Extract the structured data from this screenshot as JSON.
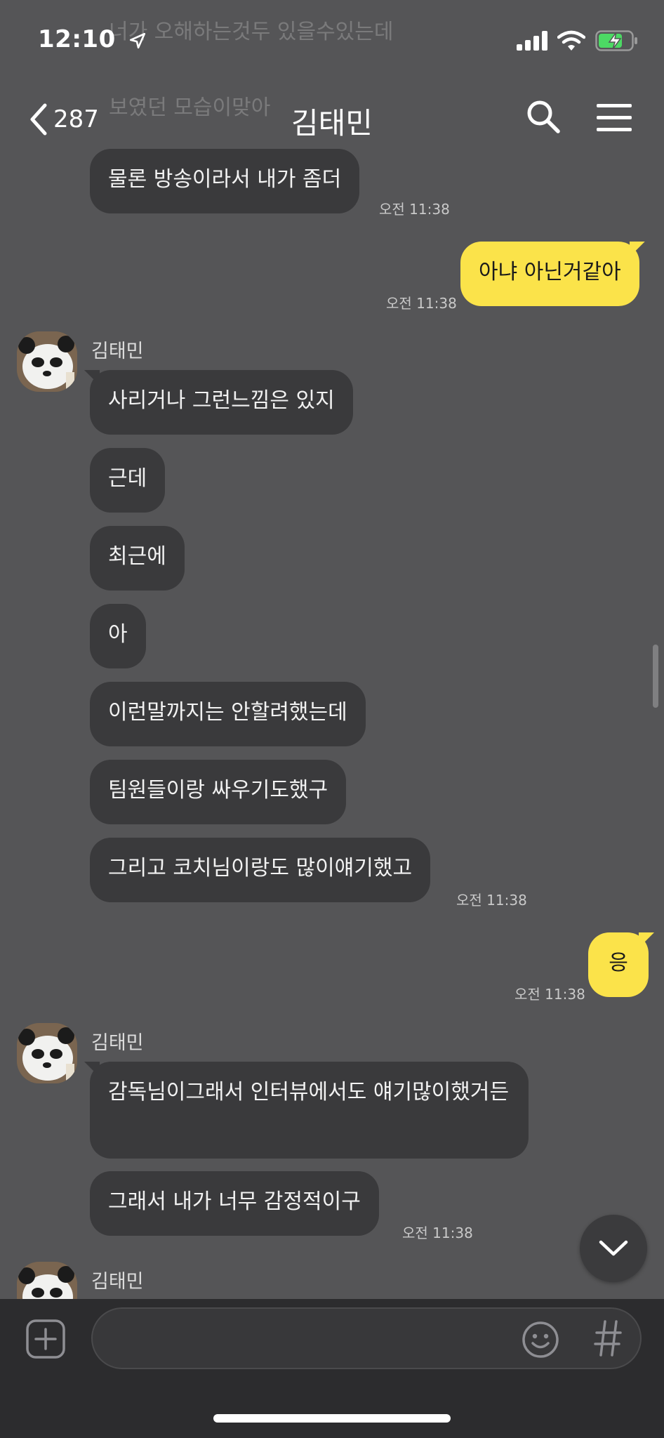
{
  "status_bar": {
    "time": "12:10"
  },
  "ghost_lines": [
    "너가 오해하는것두 있을수있는데",
    "보였던 모습이맞아"
  ],
  "header": {
    "back_count": "287",
    "title": "김태민"
  },
  "messages": [
    {
      "text": "물론 방송이라서 내가 좀더",
      "time": "오전 11:38"
    },
    {
      "text": "아냐 아닌거같아",
      "time": "오전 11:38"
    },
    {
      "sender": "김태민"
    },
    {
      "text": "사리거나 그런느낌은 있지"
    },
    {
      "text": "근데"
    },
    {
      "text": "최근에"
    },
    {
      "text": "아"
    },
    {
      "text": "이런말까지는 안할려했는데"
    },
    {
      "text": "팀원들이랑 싸우기도했구"
    },
    {
      "text": "그리고 코치님이랑도 많이얘기했고",
      "time": "오전 11:38"
    },
    {
      "text": "응",
      "time": "오전 11:38"
    },
    {
      "sender": "김태민"
    },
    {
      "text": "감독님이그래서 인터뷰에서도 얘기많이했거든"
    },
    {
      "text": "그래서 내가 너무 감정적이구",
      "time": "오전 11:38"
    },
    {
      "sender": "김태민"
    }
  ],
  "colors": {
    "background": "#555557",
    "bubble_other": "#3a3a3c",
    "bubble_me": "#fbe34a"
  },
  "icons": [
    "location-arrow-icon",
    "signal-icon",
    "wifi-icon",
    "battery-charging-icon",
    "chevron-left-icon",
    "search-icon",
    "menu-icon",
    "chevron-down-icon",
    "plus-icon",
    "emoji-icon",
    "hash-icon"
  ]
}
